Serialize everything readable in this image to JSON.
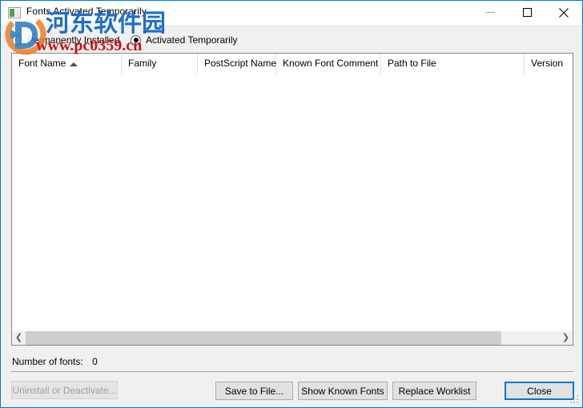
{
  "window": {
    "title": "Fonts Activated Temporarily",
    "icon": "app-window-icon",
    "accent_color": "#0078d7",
    "controls": {
      "minimize": "minimize-icon",
      "maximize": "maximize-icon",
      "close": "close-icon"
    }
  },
  "filter": {
    "options": [
      {
        "label": "Permanently Installed",
        "selected": false
      },
      {
        "label": "Activated Temporarily",
        "selected": true
      }
    ]
  },
  "list": {
    "columns": [
      {
        "label": "Font Name",
        "sort": "ascending"
      },
      {
        "label": "Family",
        "sort": ""
      },
      {
        "label": "PostScript Name",
        "sort": ""
      },
      {
        "label": "Known Font Comment",
        "sort": ""
      },
      {
        "label": "Path to File",
        "sort": ""
      },
      {
        "label": "Version",
        "sort": ""
      }
    ],
    "rows": []
  },
  "scrollbar": {
    "left_arrow": "chevron-left-icon",
    "right_arrow": "chevron-right-icon"
  },
  "status": {
    "label": "Number of fonts:",
    "count": "0"
  },
  "buttons": {
    "uninstall": "Uninstall or Deactivate...",
    "save": "Save to File...",
    "known_fonts": "Show Known Fonts",
    "replace_worklist": "Replace Worklist",
    "close": "Close"
  },
  "watermark": {
    "site_name": "河东软件园",
    "url": "www.pc0359.cn",
    "site_color": "#1f6fc4",
    "url_color": "#cc1111"
  }
}
